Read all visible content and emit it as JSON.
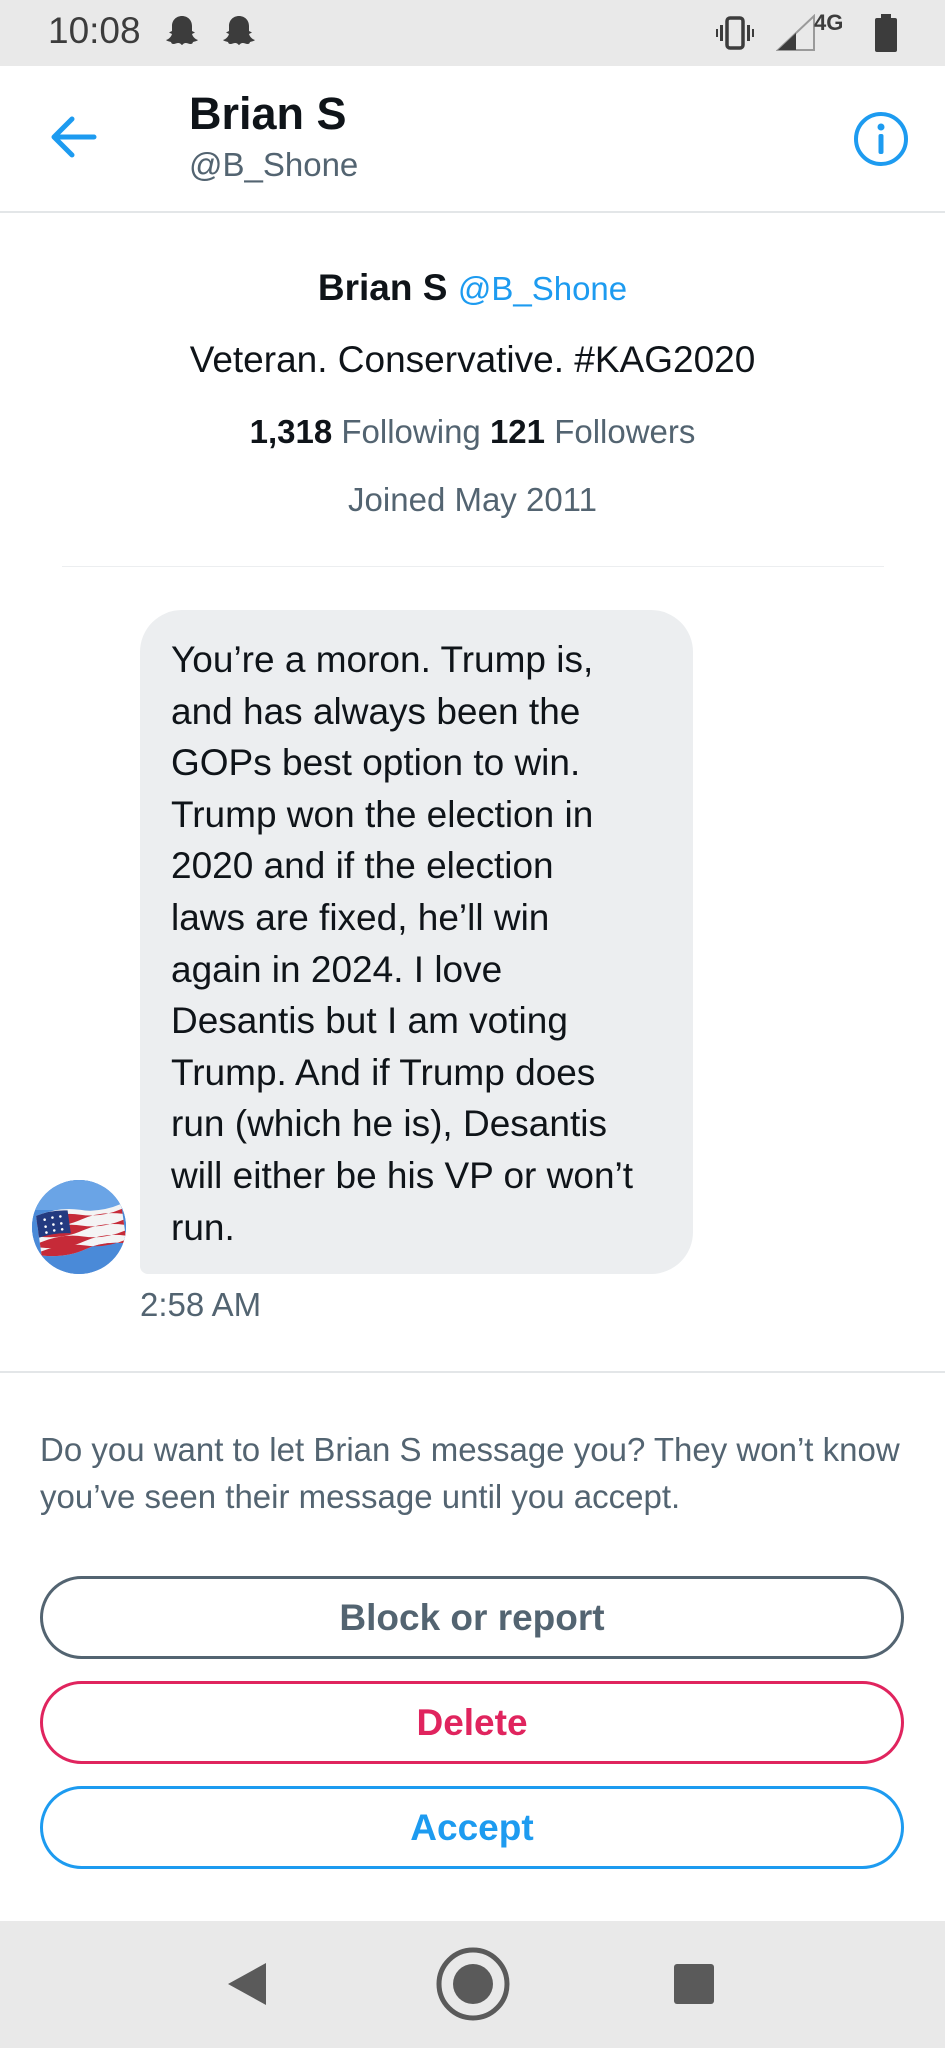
{
  "status_bar": {
    "time": "10:08",
    "notification_icons": [
      "snapchat-ghost-icon",
      "snapchat-ghost-icon"
    ],
    "network_label": "4G",
    "system_icons": [
      "vibrate-icon",
      "signal-icon",
      "battery-icon"
    ]
  },
  "header": {
    "name": "Brian S",
    "handle": "@B_Shone",
    "back_icon": "arrow-left-icon",
    "info_icon": "info-icon",
    "accent_color": "#1d9bf0"
  },
  "profile": {
    "name": "Brian S",
    "handle": "@B_Shone",
    "bio": "Veteran. Conservative. #KAG2020",
    "following_count": "1,318",
    "following_label": "Following",
    "followers_count": "121",
    "followers_label": "Followers",
    "joined": "Joined May 2011"
  },
  "message": {
    "lines": [
      "You’re a moron. Trump is,",
      "and has always been the",
      "GOPs best option to win.",
      "Trump won the election in",
      "2020 and if the election",
      "laws are fixed, he’ll win",
      "again in 2024. I love",
      "Desantis but I am voting",
      "Trump. And if Trump does",
      "run (which he is), Desantis",
      "will either be his VP or won’t",
      "run."
    ],
    "time": "2:58 AM",
    "avatar_icon": "american-flag-avatar"
  },
  "request": {
    "prompt": "Do you want to let Brian S message you? They won’t know you’ve seen their message until you accept.",
    "block_label": "Block or report",
    "delete_label": "Delete",
    "accept_label": "Accept",
    "colors": {
      "block": "#536471",
      "delete": "#e0245e",
      "accept": "#1d9bf0"
    }
  },
  "nav_bar": {
    "icons": [
      "back-triangle-icon",
      "home-circle-icon",
      "recents-square-icon"
    ]
  }
}
